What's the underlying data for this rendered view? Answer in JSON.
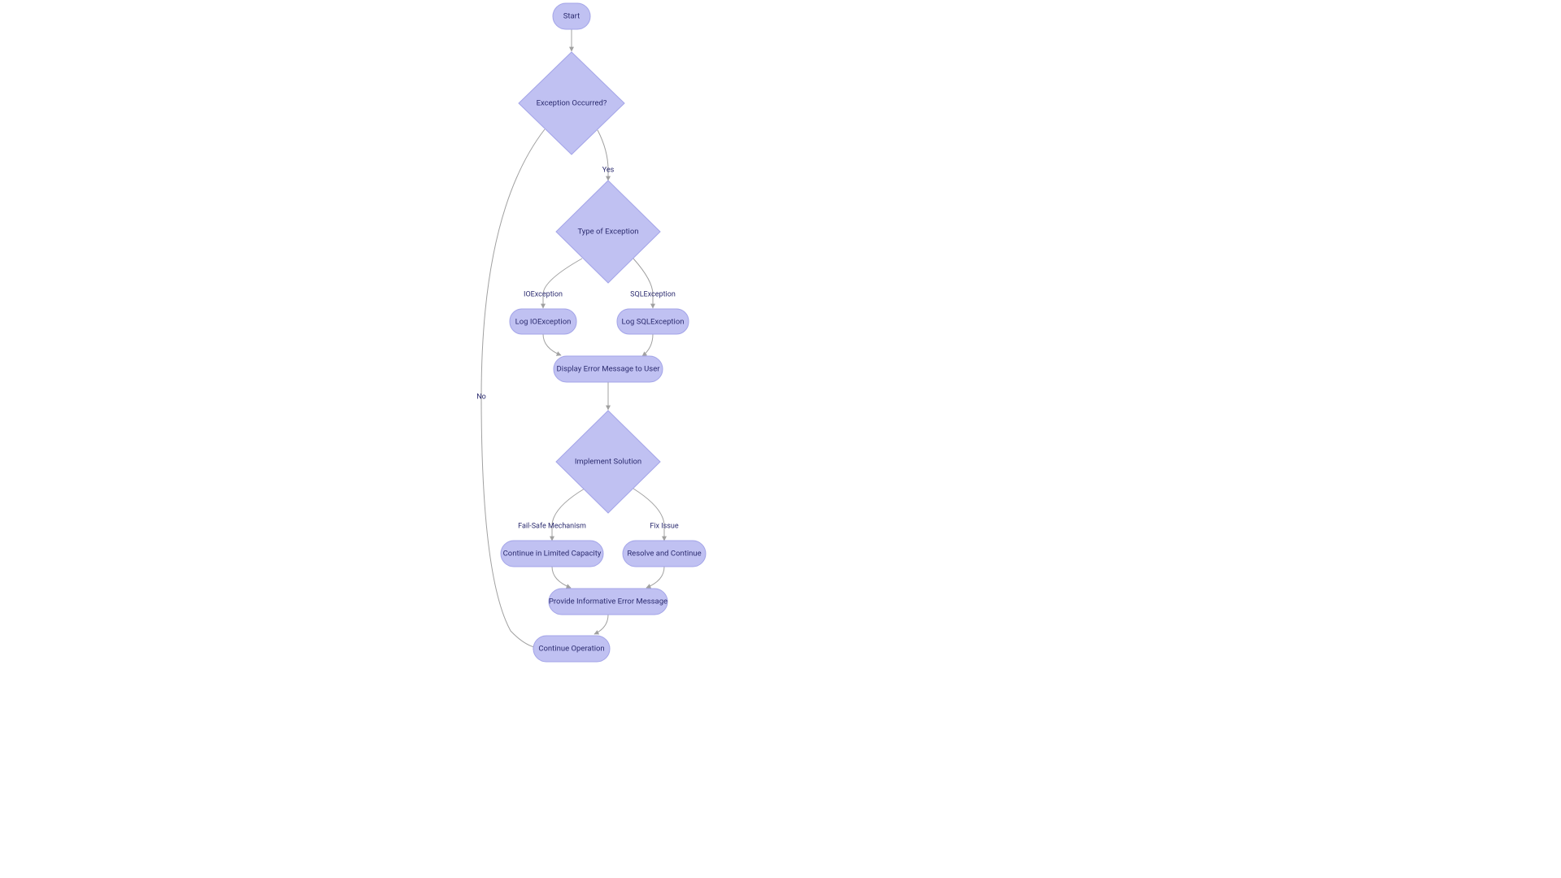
{
  "chart_data": {
    "type": "flowchart",
    "nodes": [
      {
        "id": "start",
        "shape": "rounded",
        "label": "Start"
      },
      {
        "id": "exception",
        "shape": "diamond",
        "label": "Exception Occurred?"
      },
      {
        "id": "type",
        "shape": "diamond",
        "label": "Type of Exception"
      },
      {
        "id": "logio",
        "shape": "rounded",
        "label": "Log IOException"
      },
      {
        "id": "logsql",
        "shape": "rounded",
        "label": "Log SQLException"
      },
      {
        "id": "display",
        "shape": "rounded",
        "label": "Display Error Message to User"
      },
      {
        "id": "implement",
        "shape": "diamond",
        "label": "Implement Solution"
      },
      {
        "id": "limited",
        "shape": "rounded",
        "label": "Continue in Limited Capacity"
      },
      {
        "id": "resolve",
        "shape": "rounded",
        "label": "Resolve and Continue"
      },
      {
        "id": "informative",
        "shape": "rounded",
        "label": "Provide Informative Error Message"
      },
      {
        "id": "continue",
        "shape": "rounded",
        "label": "Continue Operation"
      }
    ],
    "edges": [
      {
        "from": "start",
        "to": "exception",
        "label": ""
      },
      {
        "from": "exception",
        "to": "type",
        "label": "Yes"
      },
      {
        "from": "exception",
        "to": "continue",
        "label": "No"
      },
      {
        "from": "type",
        "to": "logio",
        "label": "IOException"
      },
      {
        "from": "type",
        "to": "logsql",
        "label": "SQLException"
      },
      {
        "from": "logio",
        "to": "display",
        "label": ""
      },
      {
        "from": "logsql",
        "to": "display",
        "label": ""
      },
      {
        "from": "display",
        "to": "implement",
        "label": ""
      },
      {
        "from": "implement",
        "to": "limited",
        "label": "Fail-Safe Mechanism"
      },
      {
        "from": "implement",
        "to": "resolve",
        "label": "Fix Issue"
      },
      {
        "from": "limited",
        "to": "informative",
        "label": ""
      },
      {
        "from": "resolve",
        "to": "informative",
        "label": ""
      },
      {
        "from": "informative",
        "to": "continue",
        "label": ""
      }
    ]
  },
  "nodes": {
    "start": "Start",
    "exception": "Exception Occurred?",
    "type": "Type of Exception",
    "logio": "Log IOException",
    "logsql": "Log SQLException",
    "display": "Display Error Message to User",
    "implement": "Implement Solution",
    "limited": "Continue in Limited Capacity",
    "resolve": "Resolve and Continue",
    "informative": "Provide Informative Error Message",
    "continue": "Continue Operation"
  },
  "edgeLabels": {
    "yes": "Yes",
    "no": "No",
    "io": "IOException",
    "sql": "SQLException",
    "failsafe": "Fail-Safe Mechanism",
    "fix": "Fix Issue"
  },
  "colors": {
    "nodeFill": "#c0c1f2",
    "nodeStroke": "#a3a4e8",
    "textColor": "#2b2b6f",
    "edgeColor": "#a0a0a0"
  }
}
